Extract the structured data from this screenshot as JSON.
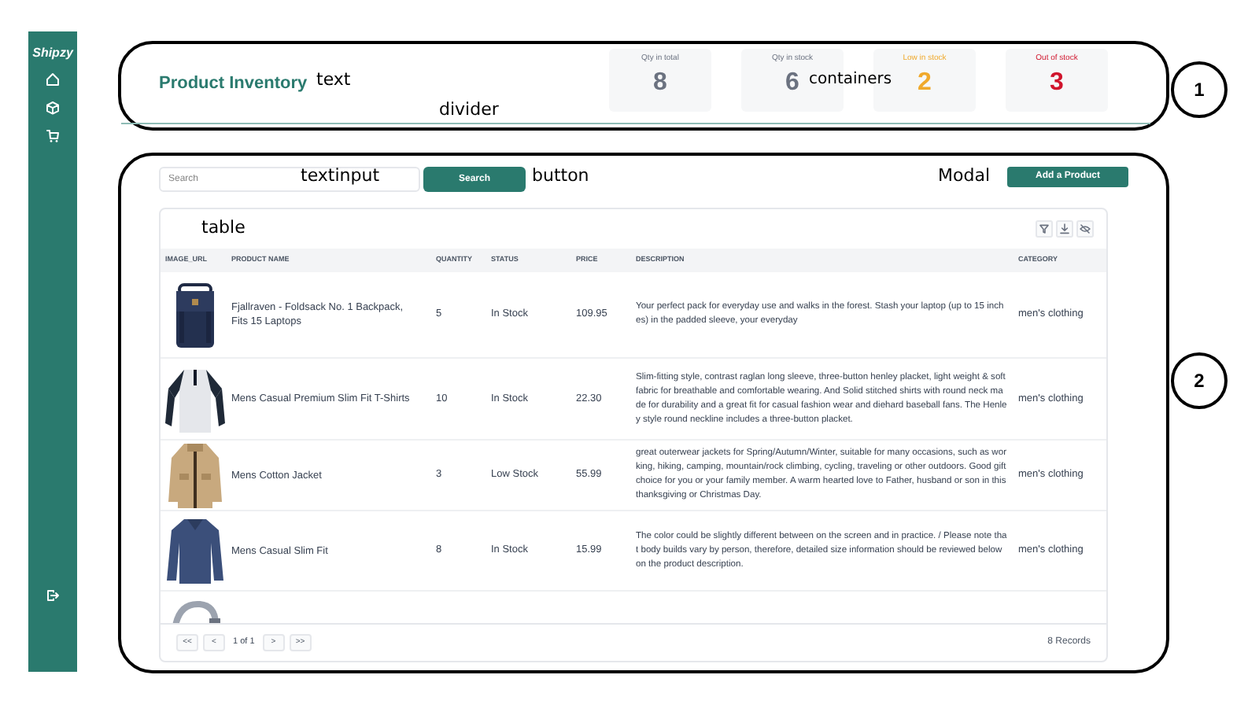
{
  "sidebar": {
    "logo": "Shipzy"
  },
  "header": {
    "title": "Product Inventory",
    "stats": [
      {
        "label": "Qty in total",
        "value": "8",
        "color": "#6b7280"
      },
      {
        "label": "Qty in stock",
        "value": "6",
        "color": "#6b7280"
      },
      {
        "label": "Low in stock",
        "value": "2",
        "color": "#f0a92c"
      },
      {
        "label": "Out of stock",
        "value": "3",
        "color": "#d0142c"
      }
    ]
  },
  "toolbar": {
    "search": {
      "placeholder": "Search"
    },
    "search_button": "Search",
    "add_button": "Add a Product"
  },
  "table": {
    "columns": [
      "IMAGE_URL",
      "PRODUCT NAME",
      "QUANTITY",
      "STATUS",
      "PRICE",
      "DESCRIPTION",
      "CATEGORY"
    ],
    "rows": [
      {
        "name": "Fjallraven - Foldsack No. 1 Backpack, Fits 15 Laptops",
        "quantity": "5",
        "status": "In Stock",
        "price": "109.95",
        "description": "Your perfect pack for everyday use and walks in the forest. Stash your laptop (up to 15 inches) in the padded sleeve, your everyday",
        "category": "men's clothing"
      },
      {
        "name": "Mens Casual Premium Slim Fit T-Shirts",
        "quantity": "10",
        "status": "In Stock",
        "price": "22.30",
        "description": "Slim-fitting style, contrast raglan long sleeve, three-button henley placket, light weight & soft fabric for breathable and comfortable wearing. And Solid stitched shirts with round neck made for durability and a great fit for casual fashion wear and diehard baseball fans. The Henley style round neckline includes a three-button placket.",
        "category": "men's clothing"
      },
      {
        "name": "Mens Cotton Jacket",
        "quantity": "3",
        "status": "Low Stock",
        "price": "55.99",
        "description": "great outerwear jackets for Spring/Autumn/Winter, suitable for many occasions, such as working, hiking, camping, mountain/rock climbing, cycling, traveling or other outdoors. Good gift choice for you or your family member. A warm hearted love to Father, husband or son in this thanksgiving or Christmas Day.",
        "category": "men's clothing"
      },
      {
        "name": "Mens Casual Slim Fit",
        "quantity": "8",
        "status": "In Stock",
        "price": "15.99",
        "description": "The color could be slightly different between on the screen and in practice. / Please note that body builds vary by person, therefore, detailed size information should be reviewed below on the product description.",
        "category": "men's clothing"
      },
      {
        "kind": "picture"
      }
    ],
    "pagination": {
      "first": "<<",
      "prev": "<",
      "page": "1 of 1",
      "next": ">",
      "last": ">>"
    },
    "records": "8 Records"
  },
  "annotations": {
    "labels": [
      "text",
      "divider",
      "containers",
      "textinput",
      "button",
      "Modal",
      "table"
    ],
    "callouts": [
      "1",
      "2"
    ]
  }
}
